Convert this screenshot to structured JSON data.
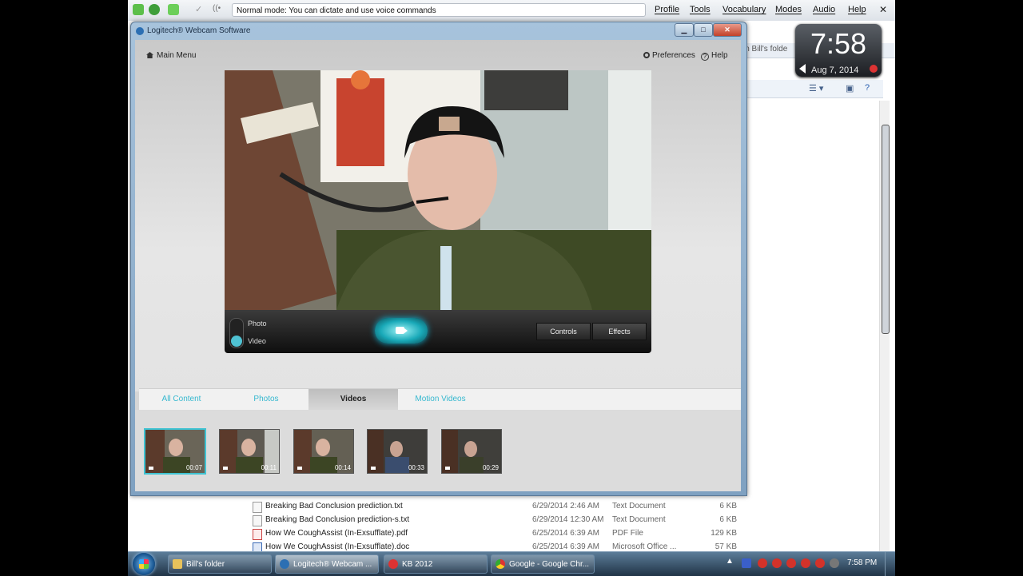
{
  "dragon": {
    "mode_text": "Normal mode: You can dictate and use voice commands",
    "menus": [
      "Profile",
      "Tools",
      "Vocabulary",
      "Modes",
      "Audio",
      "Help"
    ],
    "close_glyph": "✕"
  },
  "clock_gadget": {
    "time": "7:58",
    "date": "Aug 7, 2014"
  },
  "explorer": {
    "address_fragment": "in Bill's folde",
    "files": [
      {
        "name": "Breaking Bad Conclusion prediction.txt",
        "date": "6/29/2014 2:46 AM",
        "type": "Text Document",
        "size": "6 KB",
        "icon": "txt"
      },
      {
        "name": "Breaking Bad Conclusion prediction-s.txt",
        "date": "6/29/2014 12:30 AM",
        "type": "Text Document",
        "size": "6 KB",
        "icon": "txt"
      },
      {
        "name": "How We CoughAssist (In-Exsufflate).pdf",
        "date": "6/25/2014 6:39 AM",
        "type": "PDF File",
        "size": "129 KB",
        "icon": "pdf"
      },
      {
        "name": "How We CoughAssist (In-Exsufflate).doc",
        "date": "6/25/2014 6:39 AM",
        "type": "Microsoft Office ...",
        "size": "57 KB",
        "icon": "doc"
      }
    ]
  },
  "logitech": {
    "window_title": "Logitech® Webcam Software",
    "main_menu": "Main Menu",
    "preferences": "Preferences",
    "help": "Help",
    "mode_photo": "Photo",
    "mode_video": "Video",
    "controls": "Controls",
    "effects": "Effects",
    "tabs": [
      "All Content",
      "Photos",
      "Videos",
      "Motion Videos"
    ],
    "active_tab": "Videos",
    "thumbnails": [
      "00:07",
      "00:11",
      "00:14",
      "00:33",
      "00:29"
    ]
  },
  "taskbar": {
    "buttons": [
      "Bill's folder",
      "Logitech® Webcam ...",
      "KB 2012",
      "Google - Google Chr..."
    ],
    "time": "7:58 PM"
  },
  "colors": {
    "accent": "#35b8cf",
    "record": "#19a9b8"
  }
}
